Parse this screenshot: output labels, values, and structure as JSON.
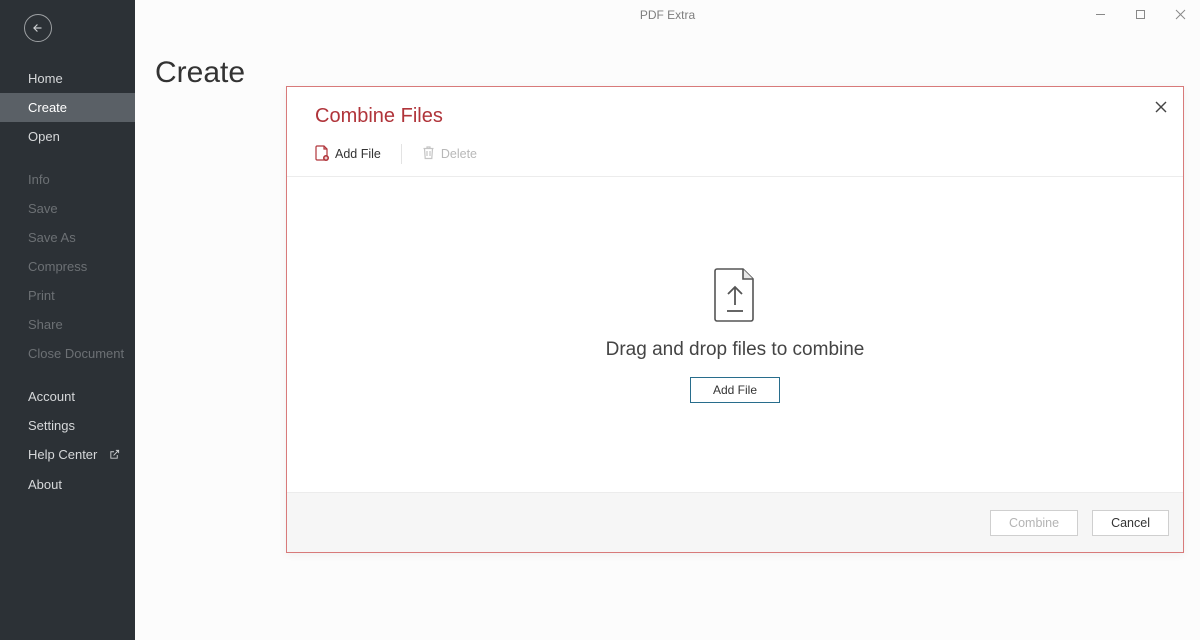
{
  "app_title": "PDF Extra",
  "page_title": "Create",
  "sidebar": {
    "items": [
      {
        "label": "Home",
        "state": "enabled"
      },
      {
        "label": "Create",
        "state": "selected"
      },
      {
        "label": "Open",
        "state": "enabled"
      },
      {
        "label": "Info",
        "state": "disabled"
      },
      {
        "label": "Save",
        "state": "disabled"
      },
      {
        "label": "Save As",
        "state": "disabled"
      },
      {
        "label": "Compress",
        "state": "disabled"
      },
      {
        "label": "Print",
        "state": "disabled"
      },
      {
        "label": "Share",
        "state": "disabled"
      },
      {
        "label": "Close Document",
        "state": "disabled"
      },
      {
        "label": "Account",
        "state": "enabled"
      },
      {
        "label": "Settings",
        "state": "enabled"
      },
      {
        "label": "Help Center",
        "state": "enabled",
        "external": true
      },
      {
        "label": "About",
        "state": "enabled"
      }
    ]
  },
  "dialog": {
    "title": "Combine Files",
    "toolbar": {
      "add_file": "Add File",
      "delete": "Delete"
    },
    "drop_text": "Drag and drop files to combine",
    "add_button": "Add File",
    "footer": {
      "combine": "Combine",
      "cancel": "Cancel"
    }
  },
  "colors": {
    "accent": "#b0343a",
    "dialog_border": "#d87a7a",
    "button_border": "#286d8c",
    "sidebar_bg": "#2c3136"
  }
}
